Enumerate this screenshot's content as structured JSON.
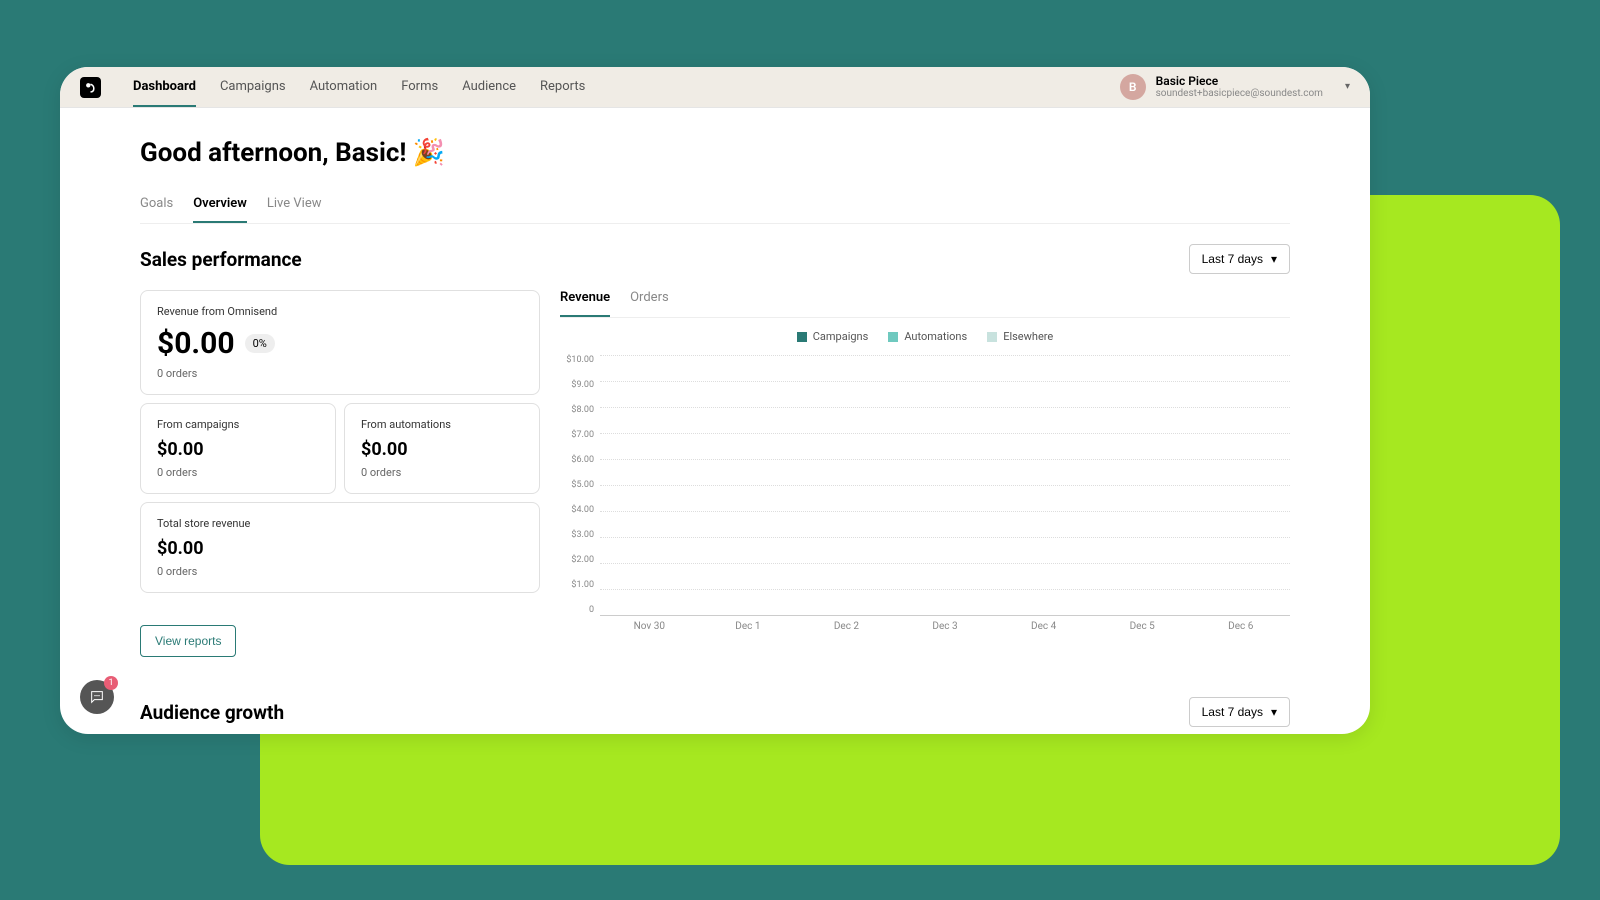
{
  "nav": {
    "items": [
      "Dashboard",
      "Campaigns",
      "Automation",
      "Forms",
      "Audience",
      "Reports"
    ],
    "active": 0
  },
  "account": {
    "initial": "B",
    "name": "Basic Piece",
    "email": "soundest+basicpiece@soundest.com"
  },
  "greeting": "Good afternoon, Basic! 🎉",
  "sub_tabs": {
    "items": [
      "Goals",
      "Overview",
      "Live View"
    ],
    "active": 1
  },
  "sections": {
    "sales": {
      "title": "Sales performance",
      "range": "Last 7 days"
    },
    "audience": {
      "title": "Audience growth",
      "range": "Last 7 days"
    }
  },
  "revenue_card": {
    "label": "Revenue from Omnisend",
    "value": "$0.00",
    "pct": "0%",
    "orders": "0 orders"
  },
  "campaigns_card": {
    "label": "From campaigns",
    "value": "$0.00",
    "orders": "0 orders"
  },
  "automations_card": {
    "label": "From automations",
    "value": "$0.00",
    "orders": "0 orders"
  },
  "total_card": {
    "label": "Total store revenue",
    "value": "$0.00",
    "orders": "0 orders"
  },
  "buttons": {
    "view_reports": "View reports"
  },
  "chart_tabs": {
    "items": [
      "Revenue",
      "Orders"
    ],
    "active": 0
  },
  "legend": {
    "campaigns": {
      "label": "Campaigns",
      "color": "#2a7a75"
    },
    "automations": {
      "label": "Automations",
      "color": "#6fc9bf"
    },
    "elsewhere": {
      "label": "Elsewhere",
      "color": "#c8e2de"
    }
  },
  "chart_data": {
    "type": "bar",
    "title": "Revenue",
    "xlabel": "",
    "ylabel": "",
    "ylim": [
      0,
      10
    ],
    "y_ticks": [
      "$10.00",
      "$9.00",
      "$8.00",
      "$7.00",
      "$6.00",
      "$5.00",
      "$4.00",
      "$3.00",
      "$2.00",
      "$1.00",
      "0"
    ],
    "categories": [
      "Nov 30",
      "Dec 1",
      "Dec 2",
      "Dec 3",
      "Dec 4",
      "Dec 5",
      "Dec 6"
    ],
    "series": [
      {
        "name": "Campaigns",
        "values": [
          0,
          0,
          0,
          0,
          0,
          0,
          0
        ]
      },
      {
        "name": "Automations",
        "values": [
          0,
          0,
          0,
          0,
          0,
          0,
          0
        ]
      },
      {
        "name": "Elsewhere",
        "values": [
          0,
          0,
          0,
          0,
          0,
          0,
          0
        ]
      }
    ]
  },
  "chat": {
    "count": "1"
  }
}
